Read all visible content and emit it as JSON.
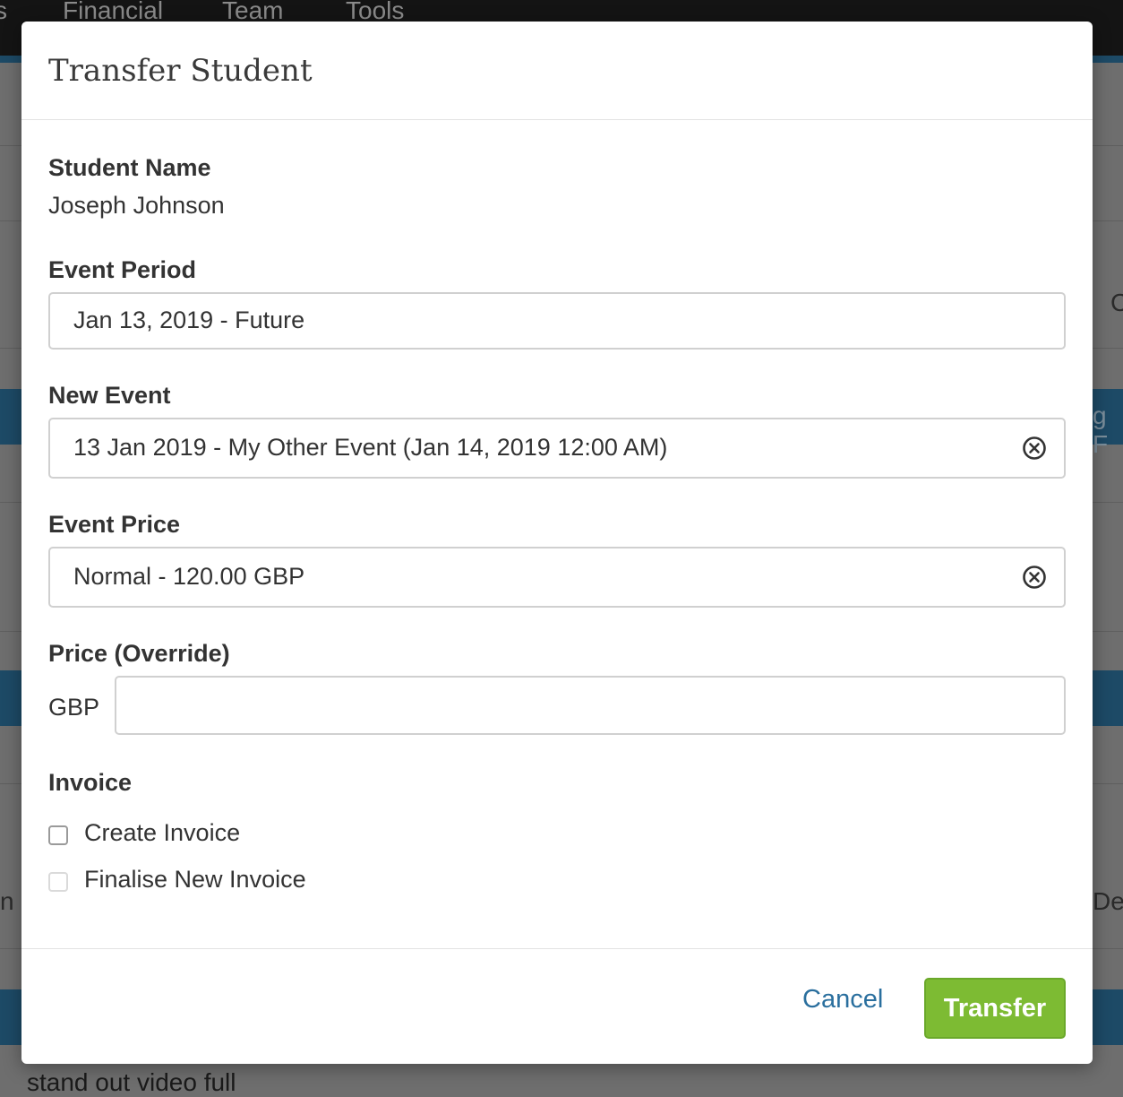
{
  "background": {
    "nav_items": [
      "s",
      "Financial",
      "Team",
      "Tools"
    ],
    "fragments": {
      "right_a": "C",
      "right_band": "g F",
      "left_bottom": "n",
      "right_bottom": "Det",
      "bottom_text": "stand out video full"
    }
  },
  "modal": {
    "title": "Transfer Student",
    "student": {
      "label": "Student Name",
      "value": "Joseph Johnson"
    },
    "event_period": {
      "label": "Event Period",
      "value": "Jan 13, 2019 - Future"
    },
    "new_event": {
      "label": "New Event",
      "value": "13 Jan 2019 - My Other Event (Jan 14, 2019 12:00 AM)"
    },
    "event_price": {
      "label": "Event Price",
      "value": "Normal - 120.00 GBP"
    },
    "price_override": {
      "label": "Price (Override)",
      "currency": "GBP",
      "value": ""
    },
    "invoice": {
      "label": "Invoice",
      "create_label": "Create Invoice",
      "finalise_label": "Finalise New Invoice"
    },
    "footer": {
      "cancel_label": "Cancel",
      "transfer_label": "Transfer"
    }
  },
  "colors": {
    "accent_green": "#7dbb33",
    "link_blue": "#2a6f9e",
    "nav_dark": "#141414",
    "band_blue": "#1d4a66"
  }
}
